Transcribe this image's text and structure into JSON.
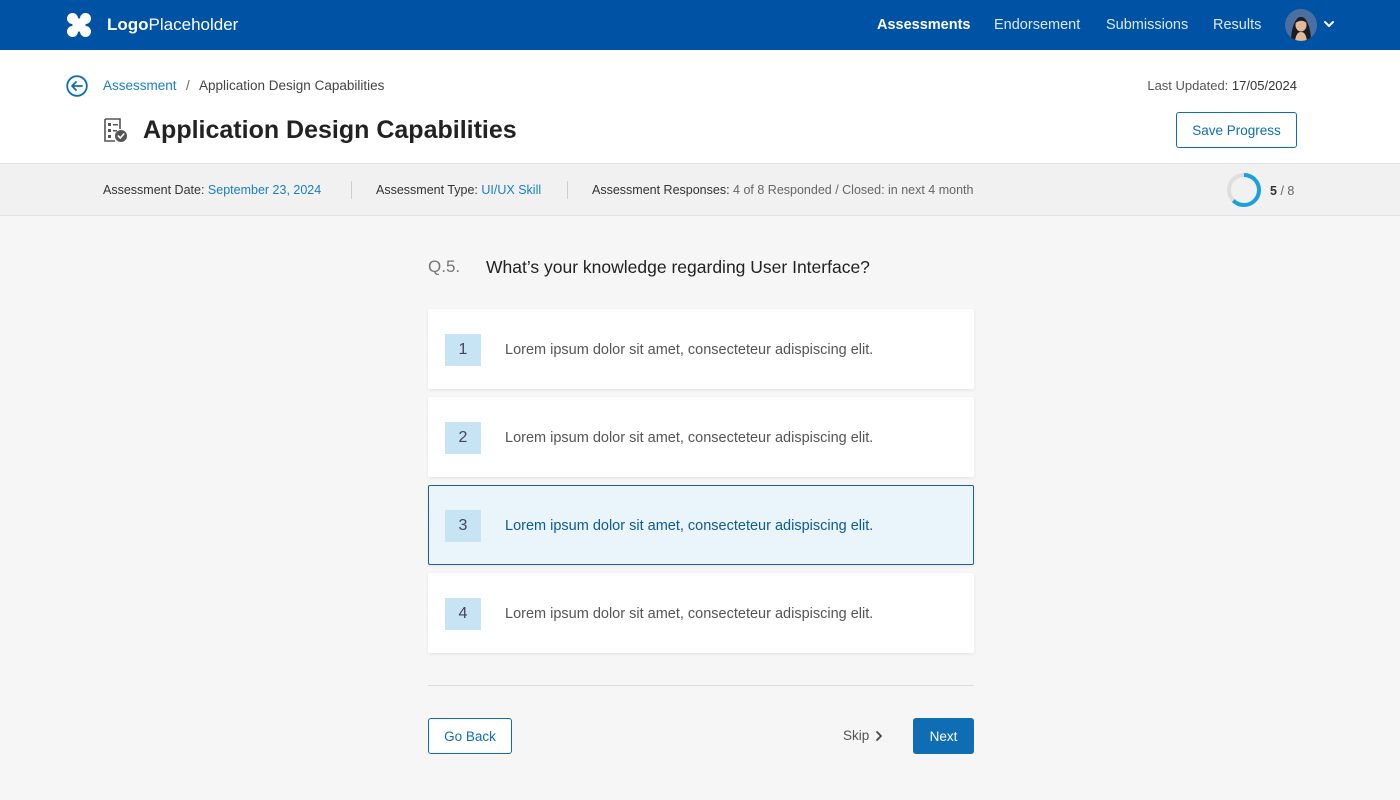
{
  "topbar": {
    "logo_bold": "Logo",
    "logo_light": "Placeholder",
    "nav": [
      {
        "label": "Assessments",
        "active": true
      },
      {
        "label": "Endorsement",
        "active": false
      },
      {
        "label": "Submissions",
        "active": false
      },
      {
        "label": "Results",
        "active": false
      }
    ],
    "brand_color": "#0052a5"
  },
  "header": {
    "breadcrumb": {
      "link": "Assessment",
      "separator": "/",
      "current": "Application Design Capabilities"
    },
    "last_updated_label": "Last Updated:",
    "last_updated_value": "17/05/2024",
    "title": "Application Design Capabilities",
    "save_label": "Save Progress"
  },
  "info": {
    "date_label": "Assessment Date:",
    "date_value": "September 23, 2024",
    "type_label": "Assessment Type:",
    "type_value": "UI/UX Skill",
    "responses_label": "Assessment Responses:",
    "responses_value": "4 of 8 Responded / Closed: in next 4 month",
    "progress_current": "5",
    "progress_total": "/ 8",
    "progress_fraction": 0.625
  },
  "question": {
    "number": "Q.5.",
    "text": "What’s your knowledge regarding User Interface?",
    "options": [
      {
        "num": "1",
        "text": "Lorem ipsum dolor sit amet, consecteteur adispiscing elit."
      },
      {
        "num": "2",
        "text": "Lorem ipsum dolor sit amet, consecteteur adispiscing elit."
      },
      {
        "num": "3",
        "text": "Lorem ipsum dolor sit amet, consecteteur adispiscing elit."
      },
      {
        "num": "4",
        "text": "Lorem ipsum dolor sit amet, consecteteur adispiscing elit."
      }
    ],
    "selected": "3"
  },
  "footer": {
    "go_back_label": "Go Back",
    "skip_label": "Skip",
    "next_label": "Next"
  },
  "colors": {
    "accent": "#0e6db3",
    "link": "#1a7fc1",
    "selected_bg": "#e9f4fb",
    "selected_border": "#1e5f96",
    "number_bg": "#c7e4f5"
  }
}
